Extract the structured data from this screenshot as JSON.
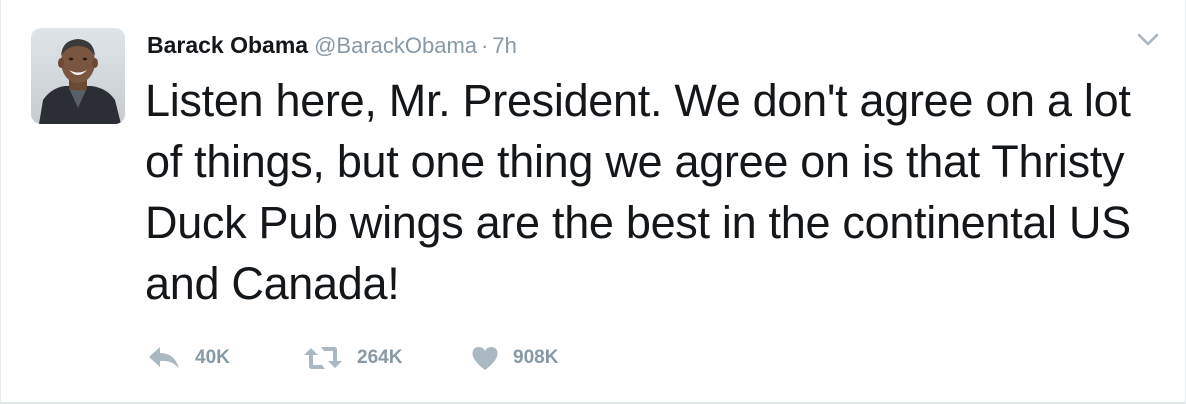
{
  "tweet": {
    "author_name": "Barack Obama",
    "author_handle": "@BarackObama",
    "separator": "·",
    "timestamp": "7h",
    "text": "Listen here, Mr. President. We don't agree on a lot of things, but one thing we agree on is that Thristy Duck Pub wings are the best in the continental US and Canada!"
  },
  "actions": {
    "reply_count": "40K",
    "retweet_count": "264K",
    "like_count": "908K"
  },
  "icons": {
    "reply": "reply-arrow-icon",
    "retweet": "retweet-icon",
    "like": "heart-icon",
    "menu": "chevron-down-icon"
  },
  "colors": {
    "text": "#14171a",
    "muted": "#8899a6",
    "icon": "#aab8c2",
    "border": "#e6ecf0"
  }
}
